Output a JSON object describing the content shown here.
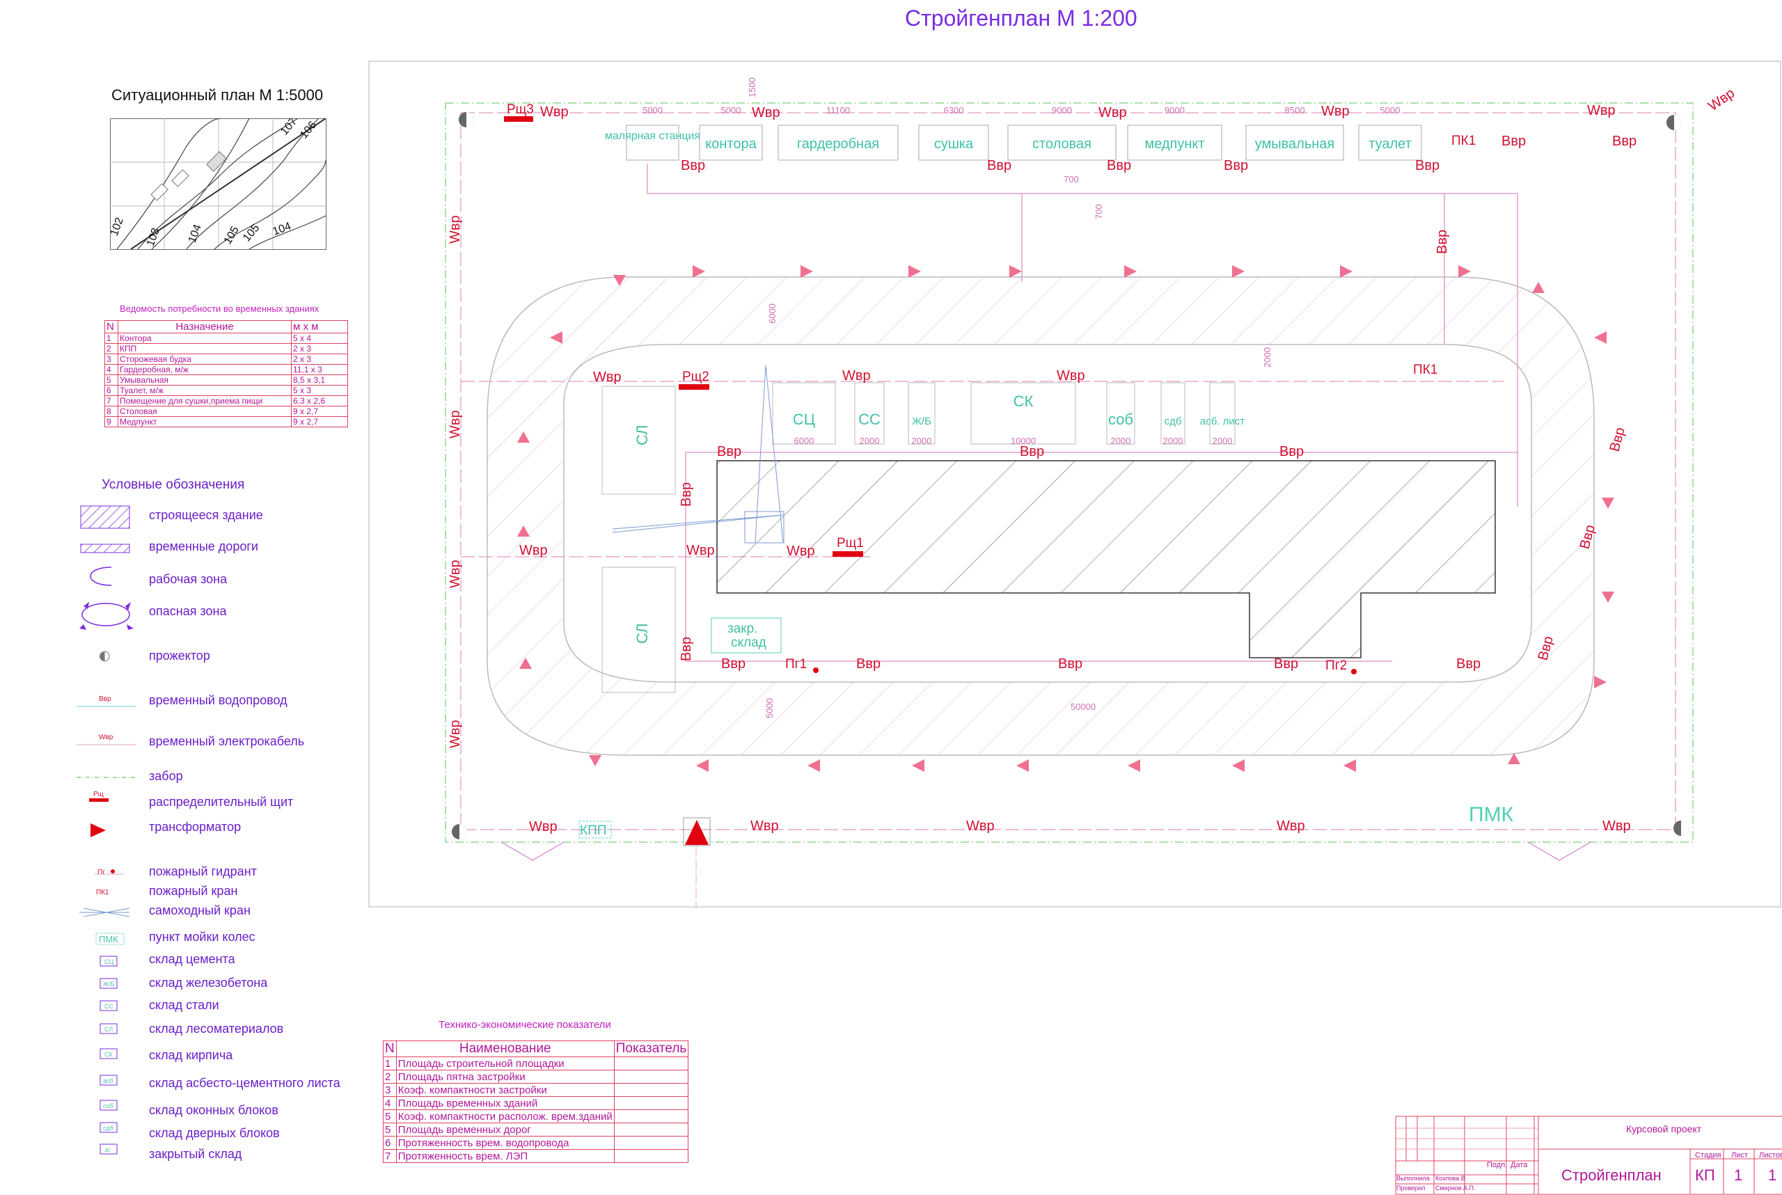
{
  "title": "Стройгенплан  М 1:200",
  "situational_plan": {
    "title": "Ситуационный план М 1:5000",
    "contour_labels": [
      "107",
      "106",
      "102",
      "103",
      "104",
      "105",
      "105",
      "104"
    ]
  },
  "vedomost": {
    "title": "Ведомость потребности во временных зданиях",
    "headers": [
      "N",
      "Назначение",
      "м х м"
    ],
    "rows": [
      [
        "1",
        "Контора",
        "5 х 4"
      ],
      [
        "2",
        "КПП",
        "2 х 3"
      ],
      [
        "3",
        "Сторожевая будка",
        "2 х 3"
      ],
      [
        "4",
        "Гардеробная, м/ж",
        "11,1 х 3"
      ],
      [
        "5",
        "Умывальная",
        "8,5 х 3,1"
      ],
      [
        "6",
        "Туалет, м/ж",
        "5 х 3"
      ],
      [
        "7",
        "Помещение для сушки,приема пищи",
        "6,3 х 2,6"
      ],
      [
        "8",
        "Столовая",
        "9 х 2,7"
      ],
      [
        "9",
        "Медпункт",
        "9 х 2,7"
      ]
    ]
  },
  "legend": {
    "title": "Условные обозначения",
    "items": [
      {
        "label": "строящееся здание",
        "icon": "hatched-building-icon"
      },
      {
        "label": "временные дороги",
        "icon": "temp-road-icon"
      },
      {
        "label": "рабочая зона",
        "icon": "work-zone-icon"
      },
      {
        "label": "опасная зона",
        "icon": "danger-zone-icon"
      },
      {
        "label": "прожектор",
        "icon": "floodlight-icon"
      },
      {
        "label": "временный водопровод",
        "icon": "water-pipe-icon",
        "sample": "Ввр"
      },
      {
        "label": "временный электрокабель",
        "icon": "cable-icon",
        "sample": "Wвр"
      },
      {
        "label": "забор",
        "icon": "fence-icon"
      },
      {
        "label": "распределительный щит",
        "icon": "switchboard-icon",
        "sample": "Рщ"
      },
      {
        "label": "трансформатор",
        "icon": "transformer-icon"
      },
      {
        "label": "пожарный гидрант",
        "icon": "hydrant-icon",
        "sample": "Пг"
      },
      {
        "label": "пожарный кран",
        "icon": "fire-valve-icon",
        "sample": "ПК1"
      },
      {
        "label": "самоходный кран",
        "icon": "crane-icon"
      },
      {
        "label": "пункт мойки колес",
        "icon": "wheel-wash-icon",
        "sample": "ПМК"
      },
      {
        "label": "склад цемента",
        "icon": "cement-store-icon",
        "sample": "СЦ"
      },
      {
        "label": "склад железобетона",
        "icon": "concrete-store-icon",
        "sample": "Ж/Б"
      },
      {
        "label": "склад стали",
        "icon": "steel-store-icon",
        "sample": "СС"
      },
      {
        "label": "склад лесоматериалов",
        "icon": "timber-store-icon",
        "sample": "СЛ"
      },
      {
        "label": "склад кирпича",
        "icon": "brick-store-icon",
        "sample": "СК"
      },
      {
        "label": "склад асбесто-цементного листа",
        "icon": "asbestos-store-icon",
        "sample": "асб"
      },
      {
        "label": "склад оконных блоков",
        "icon": "window-store-icon",
        "sample": "соб"
      },
      {
        "label": "склад дверных блоков",
        "icon": "door-store-icon",
        "sample": "сдб"
      },
      {
        "label": "закрытый склад",
        "icon": "closed-store-icon",
        "sample": "зс"
      }
    ]
  },
  "tep": {
    "title": "Технико-экономические показатели",
    "headers": [
      "N",
      "Наименование",
      "Показатель"
    ],
    "rows": [
      [
        "1",
        "Площадь строительной площадки",
        ""
      ],
      [
        "2",
        "Площадь пятна застройки",
        ""
      ],
      [
        "3",
        "Коэф. компактности застройки",
        ""
      ],
      [
        "4",
        "Площадь временных зданий",
        ""
      ],
      [
        "5",
        "Коэф. компактности располож. врем.зданий",
        ""
      ],
      [
        "5",
        "Площадь временных дорог",
        ""
      ],
      [
        "6",
        "Протяженность врем. водопровода",
        ""
      ],
      [
        "7",
        "Протяженность врем. ЛЭП",
        ""
      ]
    ]
  },
  "stamp": {
    "project": "Курсовой проект",
    "sheet_title": "Стройгенплан",
    "stage_label": "Стадия",
    "sheet_label": "Лист",
    "sheets_label": "Листов",
    "stage": "КП",
    "sheet": "1",
    "sheets": "1",
    "sign_label": "Подп.",
    "date_label": "Дата",
    "made_label": "Выполнила",
    "made_name": "Козлова В.",
    "checked_label": "Проверил",
    "checked_name": "Смирнов А.П."
  },
  "plan": {
    "temp_buildings": [
      {
        "label": "малярная станция",
        "dim": "5000"
      },
      {
        "label": "контора",
        "dim": "5000"
      },
      {
        "label": "гардеробная",
        "dim": "11100"
      },
      {
        "label": "сушка",
        "dim": "6300"
      },
      {
        "label": "столовая",
        "dim": "9000"
      },
      {
        "label": "медпункт",
        "dim": "9000"
      },
      {
        "label": "умывальная",
        "dim": "8500"
      },
      {
        "label": "туалет",
        "dim": "5000"
      }
    ],
    "storages": [
      {
        "label": "СЦ",
        "dim": "6000"
      },
      {
        "label": "СС",
        "dim": "2000"
      },
      {
        "label": "Ж/Б",
        "dim": "2000"
      },
      {
        "label": "СК",
        "dim": "10000"
      },
      {
        "label": "соб",
        "dim": "2000"
      },
      {
        "label": "сдб",
        "dim": "2000"
      },
      {
        "label": "асб. лист",
        "dim": "2000"
      }
    ],
    "labels": {
      "sl": "СЛ",
      "closed_store": "закр. склад",
      "kpp": "КПП",
      "pmk": "ПМК",
      "rsh1": "Рщ1",
      "rsh2": "Рщ2",
      "rsh3": "Рщ3",
      "pg1": "Пг1",
      "pg2": "Пг2",
      "pk1": "ПК1",
      "wvr": "Wвр",
      "vvr": "Ввр"
    },
    "dims": {
      "d1500": "1500",
      "d2000": "2000",
      "d700": "700",
      "d6000": "6000",
      "d5000": "5000",
      "d50000": "50000"
    }
  }
}
